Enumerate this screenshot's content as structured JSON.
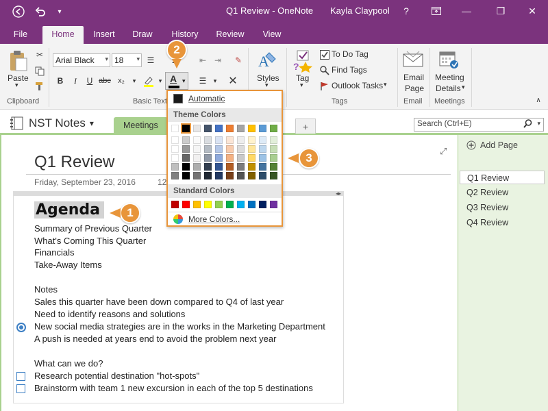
{
  "titlebar": {
    "title": "Q1 Review - OneNote",
    "user": "Kayla Claypool",
    "help": "?",
    "restore_icon": "ribbon-display-icon",
    "minimize": "—",
    "maximize": "❐",
    "close": "✕"
  },
  "tabs": [
    "File",
    "Home",
    "Insert",
    "Draw",
    "History",
    "Review",
    "View"
  ],
  "ribbon": {
    "paste": "Paste",
    "clipboard": "Clipboard",
    "font_name": "Arial Black",
    "font_size": "18",
    "basic_text": "Basic Text",
    "bold": "B",
    "italic": "I",
    "underline": "U",
    "strike": "abc",
    "subscript": "x₂",
    "font_color_letter": "A",
    "styles": "Styles",
    "tag": "Tag",
    "todo_tag": "To Do Tag",
    "find_tags": "Find Tags",
    "outlook_tasks": "Outlook Tasks",
    "tags_group": "Tags",
    "email_page_1": "Email",
    "email_page_2": "Page",
    "email_group": "Email",
    "meeting_1": "Meeting",
    "meeting_2": "Details",
    "meetings_group": "Meetings"
  },
  "notebook": {
    "name": "NST Notes",
    "section": "Meetings",
    "add_section": "+",
    "search_placeholder": "Search (Ctrl+E)"
  },
  "page": {
    "title": "Q1 Review",
    "date": "Friday, September 23, 2016",
    "time": "12",
    "agenda": "Agenda",
    "lines": [
      "Summary of Previous Quarter",
      "What's Coming This Quarter",
      "Financials",
      "Take-Away Items",
      "Notes",
      "Sales this quarter have been down compared to Q4 of last year",
      "Need to identify reasons and solutions",
      "New social media strategies are in the works in the Marketing Department",
      "A push is needed at years end to avoid the problem next year",
      "What can we do?",
      "Research potential destination \"hot-spots\"",
      "Brainstorm with team 1 new excursion in each of the top 5 destinations"
    ]
  },
  "pages_pane": {
    "add_page": "Add Page",
    "pages": [
      "Q1 Review",
      "Q2 Review",
      "Q3 Review",
      "Q4 Review"
    ]
  },
  "color_menu": {
    "automatic": "Automatic",
    "theme_colors": "Theme Colors",
    "standard_colors": "Standard Colors",
    "more_colors": "More Colors...",
    "theme_top": [
      "#ffffff",
      "#000000",
      "#e7e6e6",
      "#44546a",
      "#4472c4",
      "#ed7d31",
      "#a5a5a5",
      "#ffc000",
      "#5b9bd5",
      "#70ad47"
    ],
    "standard": [
      "#c00000",
      "#ff0000",
      "#ffc000",
      "#ffff00",
      "#92d050",
      "#00b050",
      "#00b0f0",
      "#0070c0",
      "#002060",
      "#7030a0"
    ]
  },
  "callouts": [
    "1",
    "2",
    "3"
  ],
  "accent": "#7b337d",
  "callout_color": "#e8953a"
}
